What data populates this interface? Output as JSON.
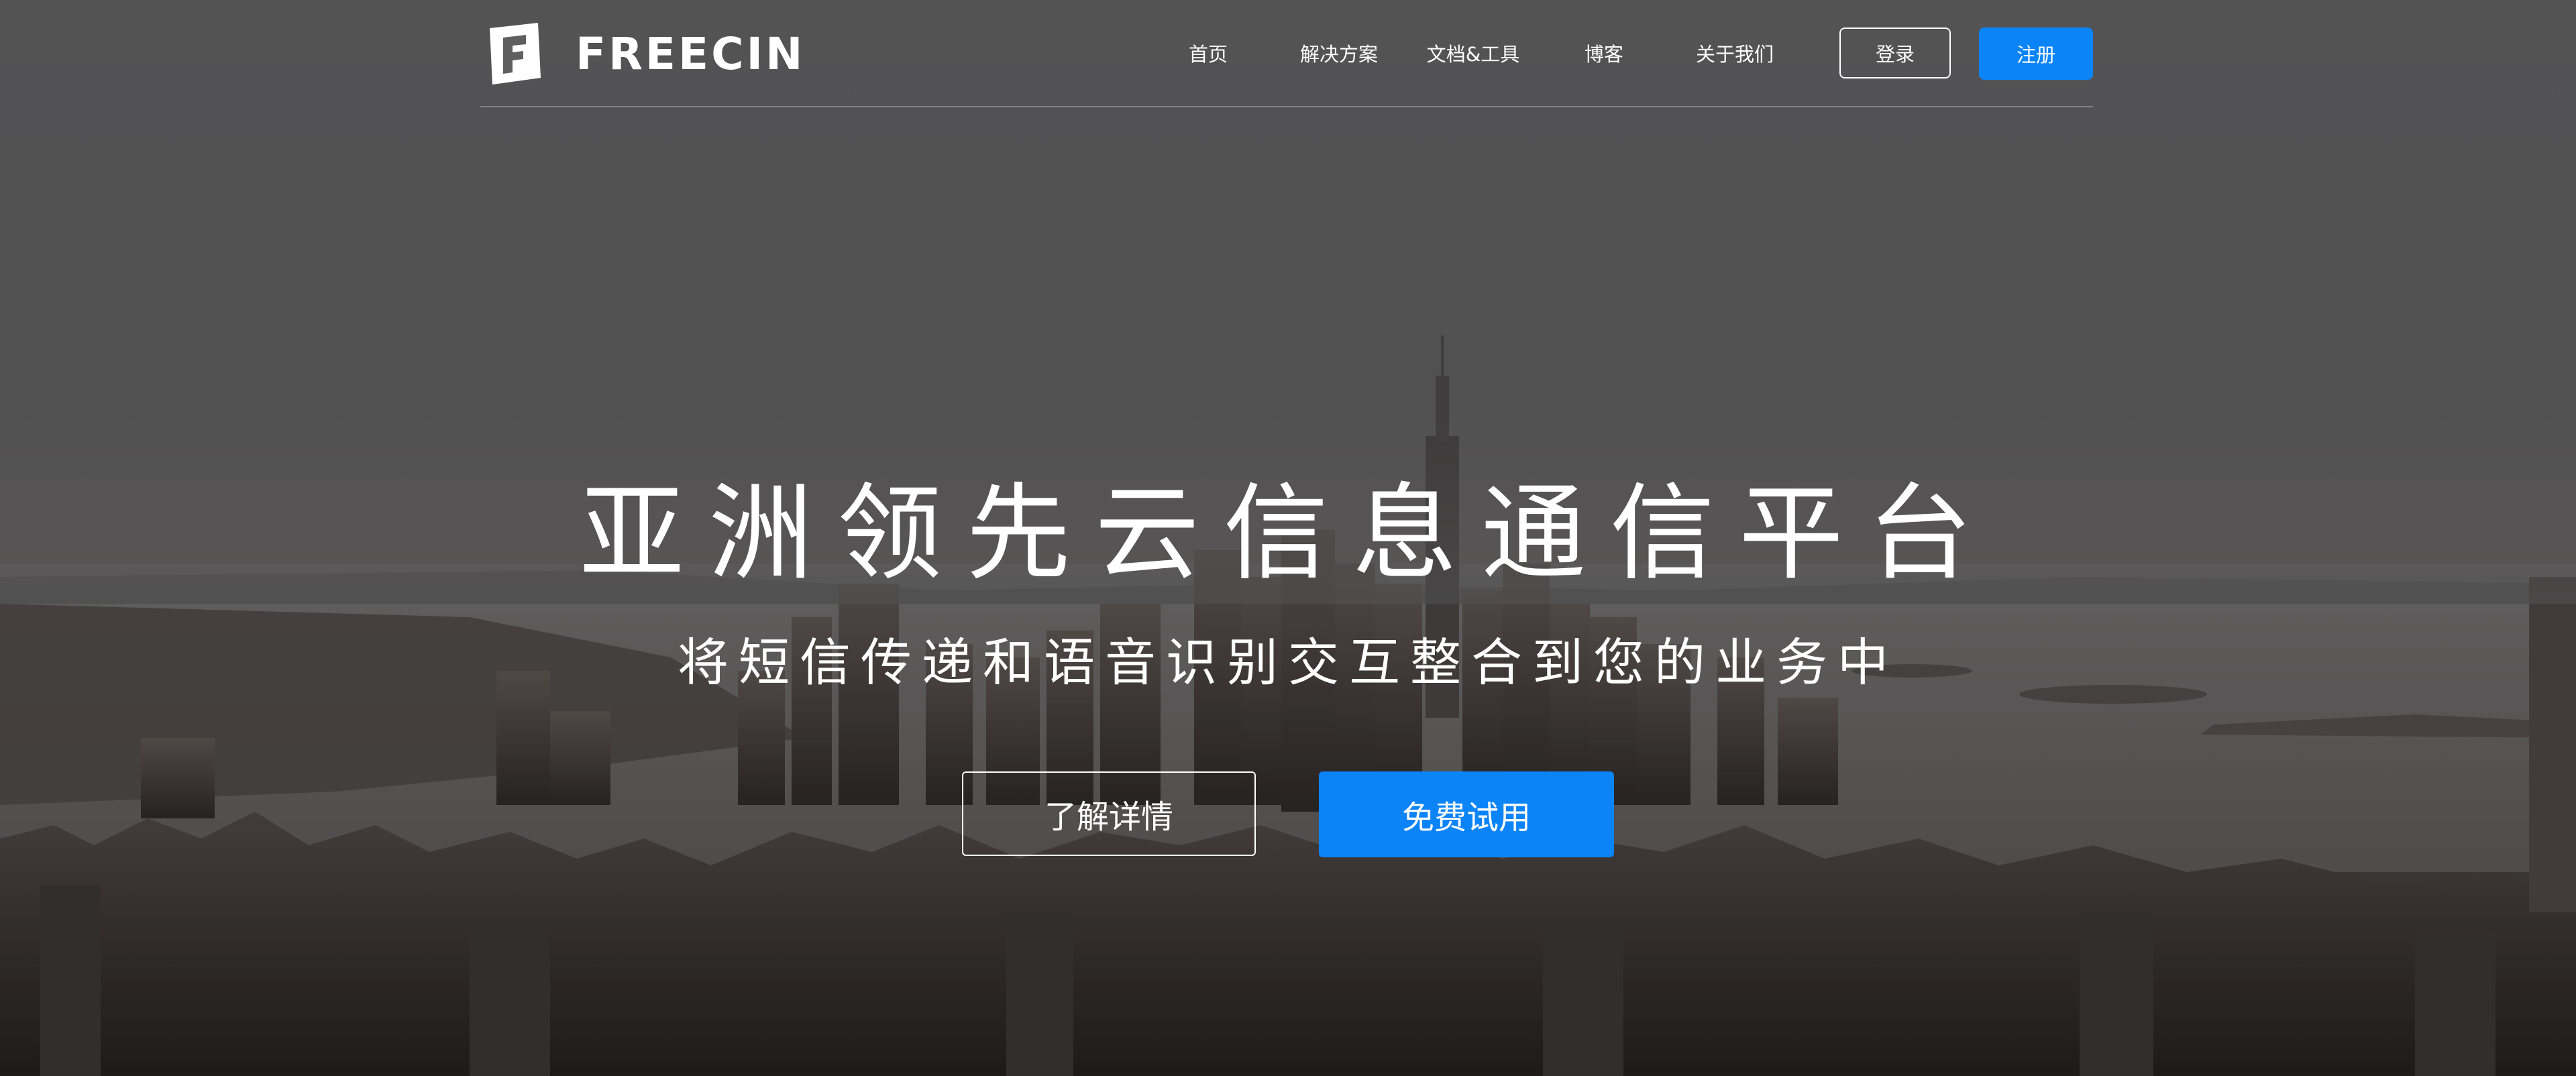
{
  "brand": {
    "name": "FREECIN",
    "logo_icon": "freecin-logo-icon"
  },
  "nav": {
    "items": [
      {
        "label": "首页"
      },
      {
        "label": "解决方案"
      },
      {
        "label": "文档&工具"
      },
      {
        "label": "博客"
      },
      {
        "label": "关于我们"
      }
    ],
    "login_label": "登录",
    "register_label": "注册"
  },
  "hero": {
    "headline": "亚洲领先云信息通信平台",
    "subheadline": "将短信传递和语音识别交互整合到您的业务中",
    "learn_more_label": "了解详情",
    "free_trial_label": "免费试用"
  },
  "colors": {
    "accent": "#0b84f7",
    "text": "#ffffff"
  }
}
